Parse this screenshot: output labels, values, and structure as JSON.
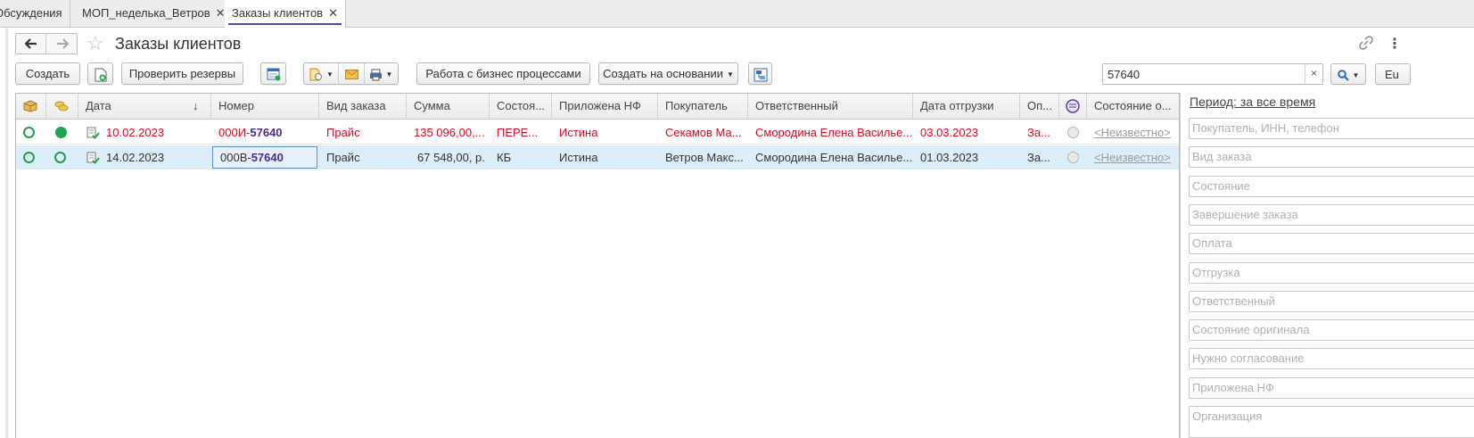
{
  "tabs": [
    {
      "label": "Обсуждения",
      "closable": false,
      "active": false
    },
    {
      "label": "МОП_неделька_Ветров",
      "closable": true,
      "active": false
    },
    {
      "label": "Заказы клиентов",
      "closable": true,
      "active": true
    }
  ],
  "tab_close_glyph": "✕",
  "header": {
    "title": "Заказы клиентов"
  },
  "toolbar": {
    "create": "Создать",
    "check_reserves": "Проверить резервы",
    "business_processes": "Работа с бизнес процессами",
    "create_based_on": "Создать на основании",
    "search_value": "57640",
    "search_clear": "×",
    "cut_button": "Eu"
  },
  "table": {
    "columns": [
      "Дата",
      "Номер",
      "Вид заказа",
      "Сумма",
      "Состоя...",
      "Приложена НФ",
      "Покупатель",
      "Ответственный",
      "Дата отгрузки",
      "Оп...",
      "Состояние о..."
    ],
    "sort_glyph": "↓",
    "rows": [
      {
        "status1": "open",
        "status2": "filled",
        "date": "10.02.2023",
        "number_prefix": "000И-",
        "number_match": "57640",
        "kind": "Прайс",
        "sum": "135 096,00,...",
        "state": "ПЕРЕ...",
        "nf": "Истина",
        "buyer": "Секамов Ма...",
        "responsible": "Смородина Елена Василье...",
        "ship_date": "03.03.2023",
        "op": "За...",
        "orig_state": "<Неизвестно>",
        "highlight": "red",
        "selected": false
      },
      {
        "status1": "open",
        "status2": "open",
        "date": "14.02.2023",
        "number_prefix": "000В-",
        "number_match": "57640",
        "kind": "Прайс",
        "sum": "67 548,00, р.",
        "state": "КБ",
        "nf": "Истина",
        "buyer": "Ветров Макс...",
        "responsible": "Смородина Елена Василье...",
        "ship_date": "01.03.2023",
        "op": "За...",
        "orig_state": "<Неизвестно>",
        "highlight": "none",
        "selected": true
      }
    ]
  },
  "filters": {
    "period": "Период: за все время",
    "fields": [
      "Покупатель, ИНН, телефон",
      "Вид заказа",
      "Состояние",
      "Завершение заказа",
      "Оплата",
      "Отгрузка",
      "Ответственный",
      "Состояние оригинала",
      "Нужно согласование",
      "Приложена НФ",
      "Организация"
    ]
  },
  "colors": {
    "accent": "#5c3f9e",
    "red": "#e0061e",
    "green": "#1fa551",
    "selection": "#ddeefb"
  }
}
